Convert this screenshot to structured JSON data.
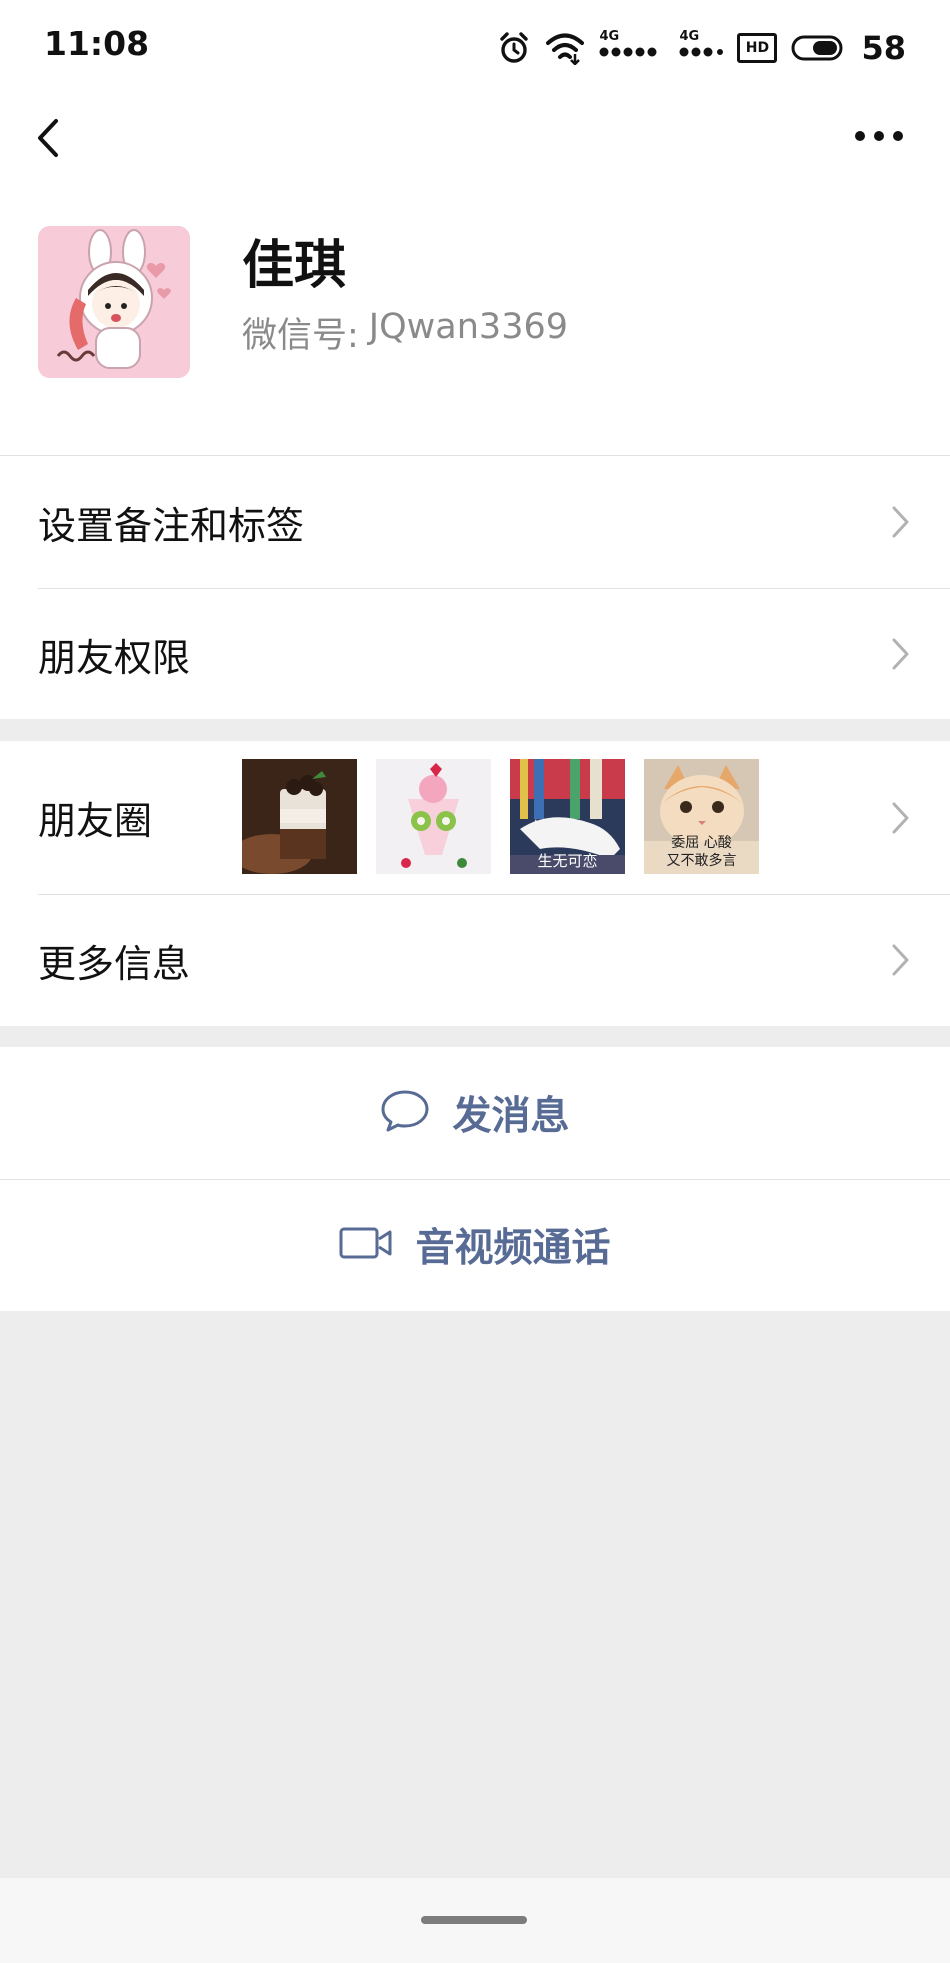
{
  "status_bar": {
    "time": "11:08",
    "network_1": "4G",
    "network_2": "4G",
    "hd_label": "HD",
    "battery": "58"
  },
  "nav": {
    "back_icon": "chevron-left-icon",
    "more_icon": "more-dots-icon"
  },
  "profile": {
    "name": "佳琪",
    "wechat_id_label": "微信号:",
    "wechat_id": "JQwan3369"
  },
  "list_group_1": [
    {
      "label": "设置备注和标签"
    },
    {
      "label": "朋友权限"
    }
  ],
  "list_group_2": {
    "moments_label": "朋友圈",
    "moments_thumbs": [
      {
        "caption": ""
      },
      {
        "caption": ""
      },
      {
        "caption": "生无可恋"
      },
      {
        "caption": "委屈 心酸\n又不敢多言"
      }
    ],
    "more_info_label": "更多信息"
  },
  "actions": {
    "send_message": "发消息",
    "video_call": "音视频通话"
  },
  "colors": {
    "link_blue": "#576b95",
    "page_bg": "#ededed",
    "chevron_gray": "#b2b2b2"
  }
}
